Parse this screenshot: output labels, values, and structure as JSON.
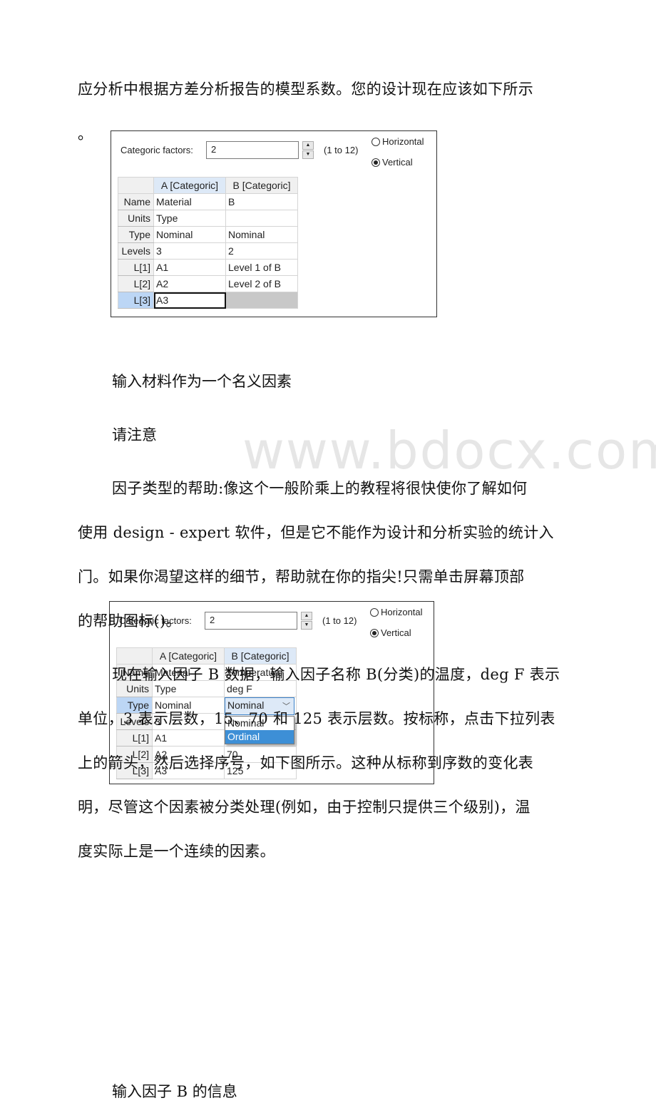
{
  "paragraphs": {
    "intro_line1": "应分析中根据方差分析报告的模型系数。您的设计现在应该如下所示",
    "intro_line2": "。",
    "caption1": "输入材料作为一个名义因素",
    "note_title": "请注意",
    "help_p_lines": [
      "因子类型的帮助:像这个一般阶乘上的教程将很快使你了解如何",
      "使用 design - expert 软件，但是它不能作为设计和分析实验的统计入",
      "门。如果你渴望这样的细节，帮助就在你的指尖!只需单击屏幕顶部",
      "的帮助图标()。"
    ],
    "factor_b_lines": [
      "现在输入因子 B 数据，输入因子名称 B(分类)的温度，deg F 表示",
      "单位，3 表示层数，15、70 和 125 表示层数。按标称，点击下拉列表",
      "上的箭头，然后选择序号，如下图所示。这种从标称到序数的变化表",
      "明，尽管这个因素被分类处理(例如，由于控制只提供三个级别)，温",
      "度实际上是一个连续的因素。"
    ],
    "caption2": "输入因子 B 的信息"
  },
  "watermark": "www.bdocx.com",
  "dialog1": {
    "factors_label": "Categoric factors:",
    "factors_value": "2",
    "range": "(1 to 12)",
    "radio_horizontal": "Horizontal",
    "radio_vertical": "Vertical",
    "selected_orientation": "Vertical",
    "columns": [
      "A [Categoric]",
      "B [Categoric]"
    ],
    "rows": [
      {
        "header": "Name",
        "a": "Material",
        "b": "B"
      },
      {
        "header": "Units",
        "a": "Type",
        "b": ""
      },
      {
        "header": "Type",
        "a": "Nominal",
        "b": "Nominal"
      },
      {
        "header": "Levels",
        "a": "3",
        "b": "2"
      },
      {
        "header": "L[1]",
        "a": "A1",
        "b": "Level 1 of B"
      },
      {
        "header": "L[2]",
        "a": "A2",
        "b": "Level 2 of B"
      },
      {
        "header": "L[3]",
        "a": "A3",
        "b": ""
      }
    ]
  },
  "dialog2": {
    "factors_label": "Categoric factors:",
    "factors_value": "2",
    "range": "(1 to 12)",
    "radio_horizontal": "Horizontal",
    "radio_vertical": "Vertical",
    "selected_orientation": "Vertical",
    "columns": [
      "A [Categoric]",
      "B [Categoric]"
    ],
    "rows": [
      {
        "header": "Name",
        "a": "Material",
        "b": "Temperature"
      },
      {
        "header": "Units",
        "a": "Type",
        "b": "deg F"
      },
      {
        "header": "Type",
        "a": "Nominal",
        "b": "Nominal"
      },
      {
        "header": "Levels",
        "a": "3",
        "b": ""
      },
      {
        "header": "L[1]",
        "a": "A1",
        "b": ""
      },
      {
        "header": "L[2]",
        "a": "A2",
        "b": "70"
      },
      {
        "header": "L[3]",
        "a": "A3",
        "b": "125"
      }
    ],
    "type_combo_value": "Nominal",
    "type_options": [
      "Nominal",
      "Ordinal"
    ],
    "highlighted_option": "Ordinal"
  }
}
